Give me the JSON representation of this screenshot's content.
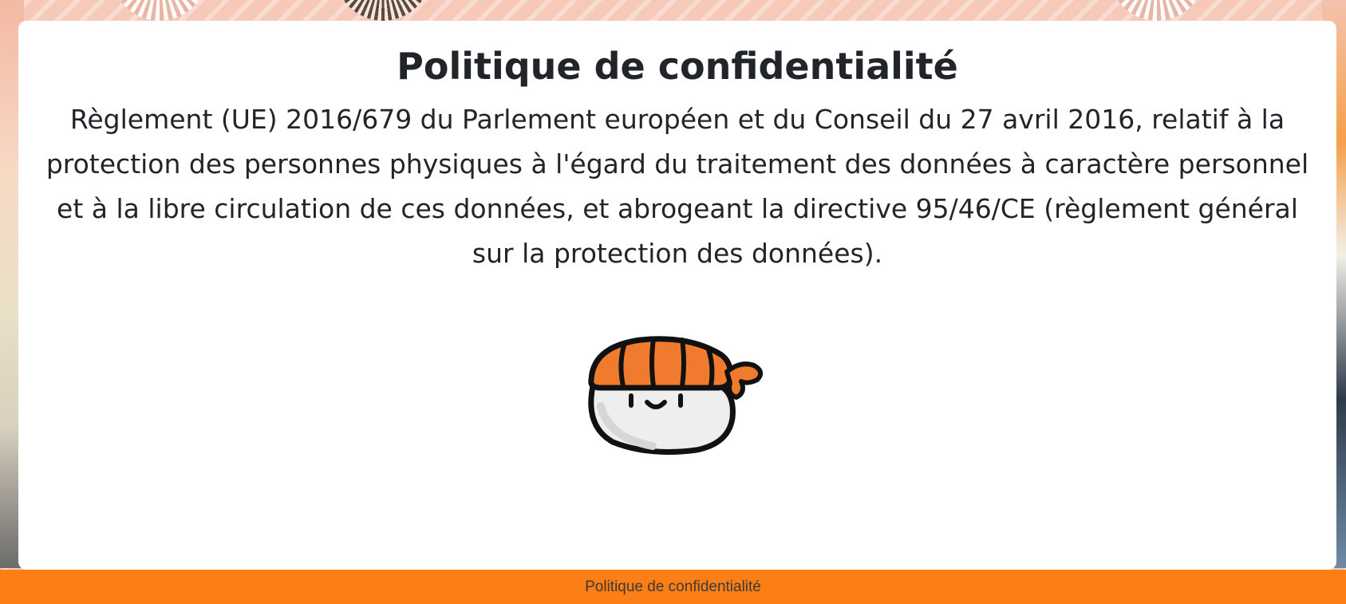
{
  "page": {
    "title": "Politique de confidentialité",
    "intro": "Règlement (UE) 2016/679 du Parlement européen et du Conseil du 27 avril 2016, relatif à la protection des personnes physiques à l'égard du traitement des données à caractère personnel et à la libre circulation de ces données, et abrogeant la directive 95/46/CE (règlement général sur la protection des données)."
  },
  "mascot": {
    "icon": "sushi-mascot-icon"
  },
  "footer": {
    "link_label": "Politique de confidentialité"
  },
  "colors": {
    "footer_bg": "#fd7e14",
    "card_bg": "#ffffff",
    "text": "#212529",
    "salmon": "#f07a2e"
  }
}
